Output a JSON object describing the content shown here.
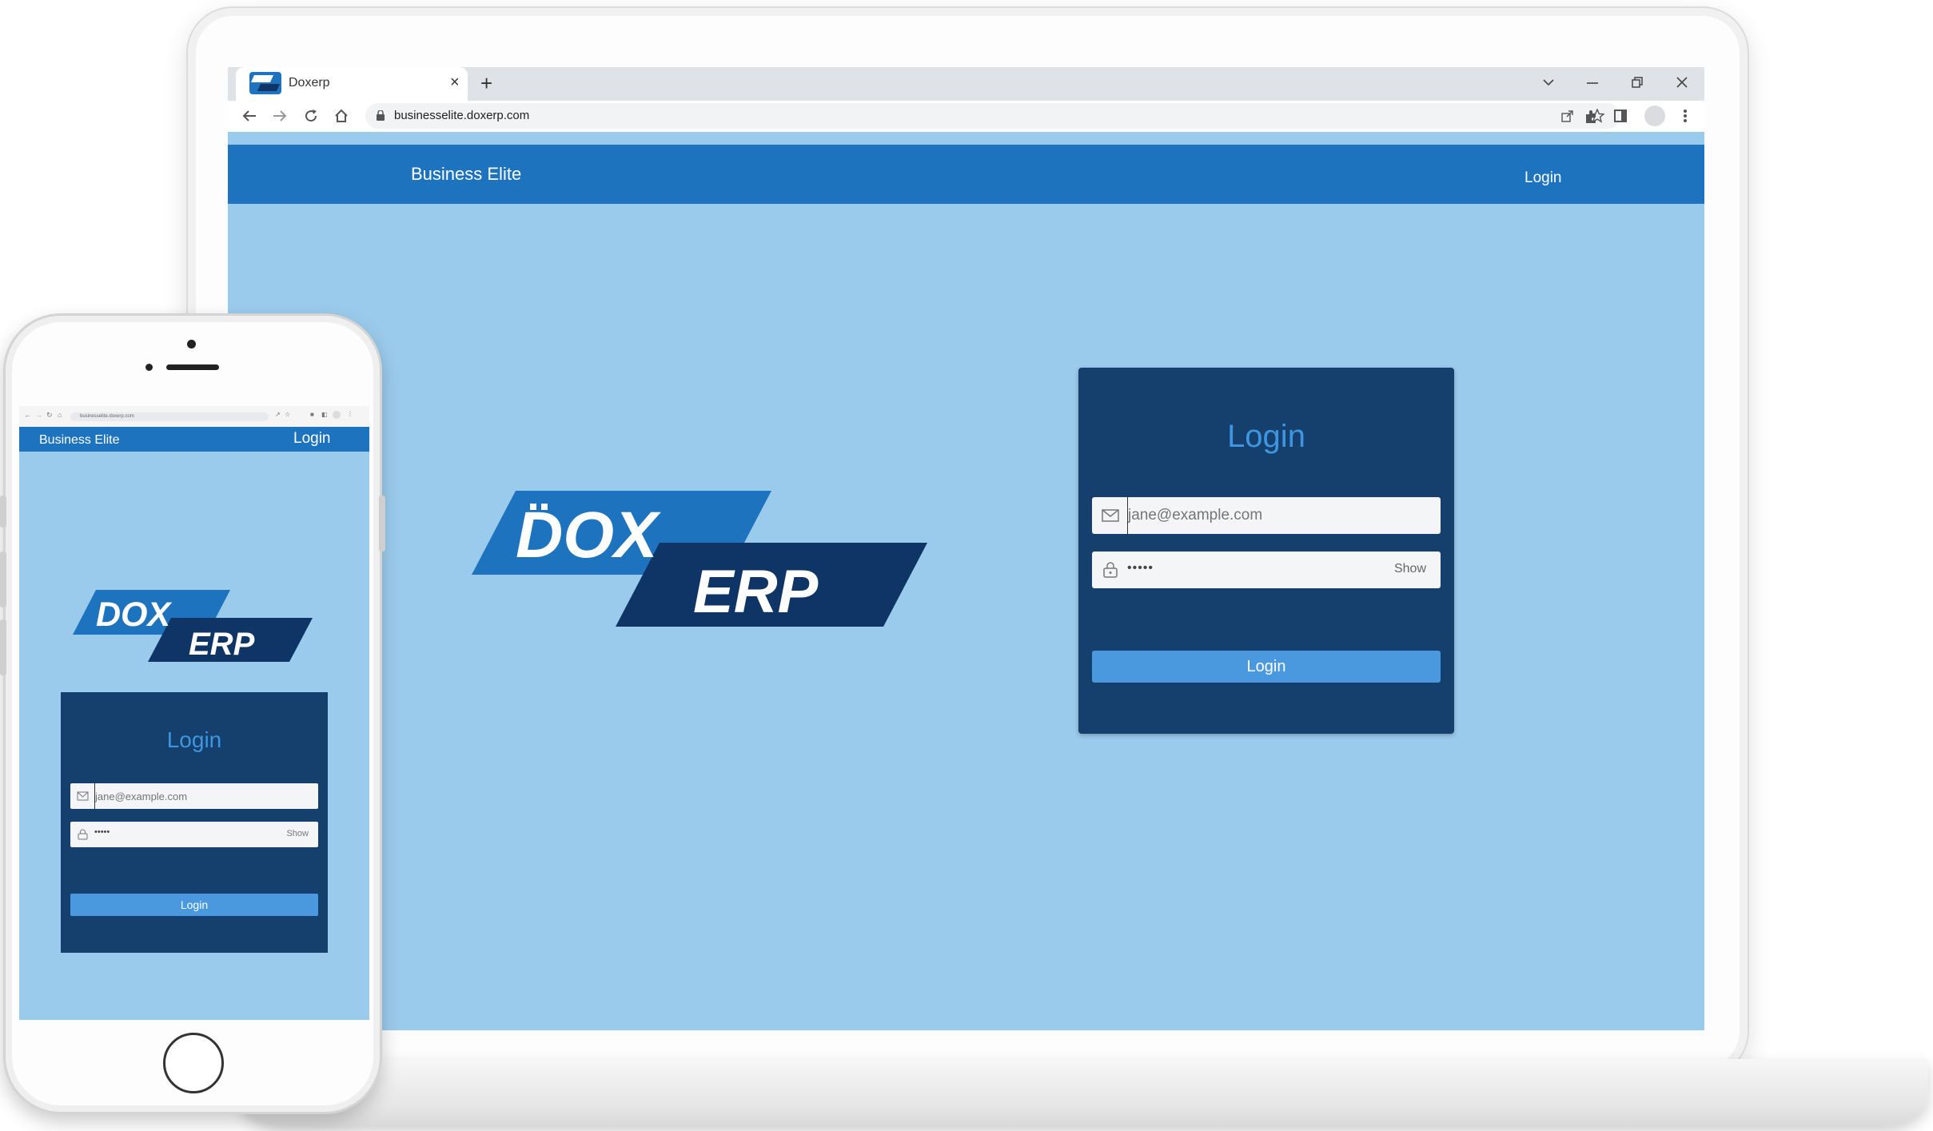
{
  "browser": {
    "tab_title": "Doxerp",
    "url": "businesselite.doxerp.com",
    "new_tab_glyph": "+",
    "close_tab_glyph": "×"
  },
  "app": {
    "brand": "Business Elite",
    "header_login": "Login",
    "logo": {
      "line1": "DOX",
      "line2": "ERP"
    },
    "login_card": {
      "title": "Login",
      "email_placeholder": "jane@example.com",
      "password_mask": "•••••",
      "show_label": "Show",
      "submit_label": "Login"
    }
  },
  "mobile": {
    "url": "businesselite.doxerp.com",
    "brand": "Business Elite",
    "header_login": "Login",
    "logo": {
      "line1": "DOX",
      "line2": "ERP"
    },
    "login_card": {
      "title": "Login",
      "email_placeholder": "jane@example.com",
      "password_mask": "•••••",
      "show_label": "Show",
      "submit_label": "Login"
    }
  },
  "icons": {
    "email": "envelope-icon",
    "password": "lock-icon",
    "back": "arrow-left-icon",
    "forward": "arrow-right-icon",
    "reload": "reload-icon",
    "home": "home-icon"
  },
  "colors": {
    "header_blue": "#1e73be",
    "background": "#9bcbec",
    "card": "#153f6d",
    "accent": "#4a99df",
    "logo_dark": "#0e3566"
  }
}
